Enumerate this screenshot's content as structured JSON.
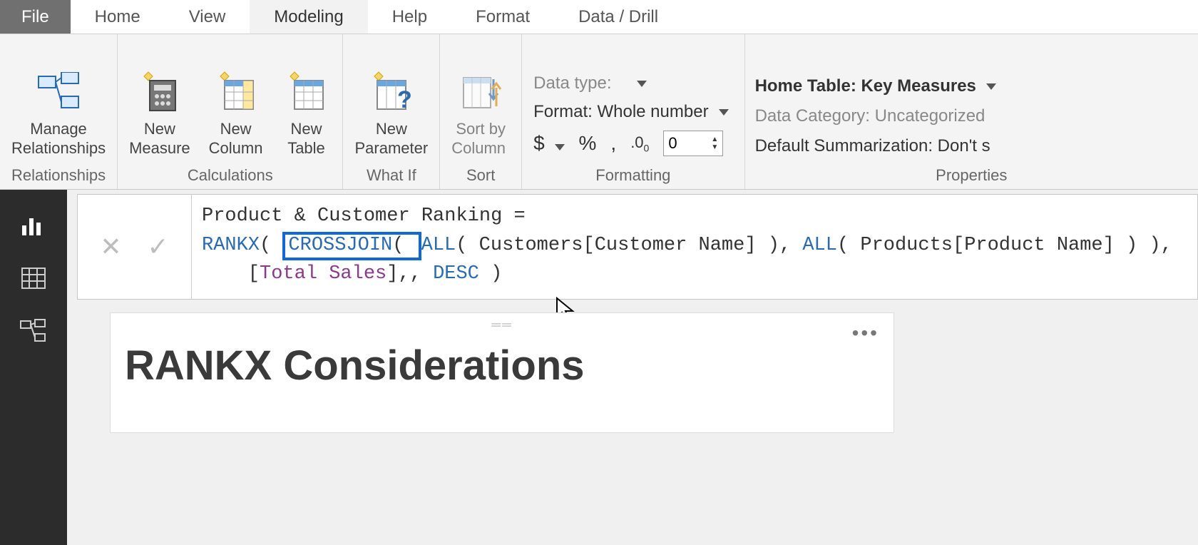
{
  "menu": {
    "file": "File",
    "items": [
      "Home",
      "View",
      "Modeling",
      "Help",
      "Format",
      "Data / Drill"
    ],
    "active_index": 2
  },
  "ribbon": {
    "relationships": {
      "group_label": "Relationships",
      "manage": "Manage\nRelationships"
    },
    "calculations": {
      "group_label": "Calculations",
      "new_measure": "New\nMeasure",
      "new_column": "New\nColumn",
      "new_table": "New\nTable"
    },
    "whatif": {
      "group_label": "What If",
      "new_parameter": "New\nParameter"
    },
    "sort": {
      "group_label": "Sort",
      "sort_by": "Sort by\nColumn"
    },
    "formatting": {
      "group_label": "Formatting",
      "data_type": "Data type:",
      "format": "Format: Whole number",
      "currency": "$",
      "percent": "%",
      "comma": ",",
      "decimal_icon": ".0₀",
      "decimal_value": "0"
    },
    "properties": {
      "group_label": "Properties",
      "home_table": "Home Table: Key Measures",
      "data_category": "Data Category: Uncategorized",
      "default_summ": "Default Summarization: Don't s"
    }
  },
  "formula": {
    "line1_prefix": "Product & Customer Ranking = ",
    "rankx": "RANKX",
    "lparen1": "( ",
    "crossjoin": "CROSSJOIN",
    "lparen2": "( ",
    "all1": "ALL",
    "arg1": "( Customers[Customer Name] ), ",
    "all2": "ALL",
    "arg2": "( Products[Product Name] ) ),",
    "indent": "    [",
    "total_sales": "Total Sales",
    "mid": "],, ",
    "desc": "DESC",
    "end": " )"
  },
  "visual": {
    "title": "RANKX Considerations"
  }
}
